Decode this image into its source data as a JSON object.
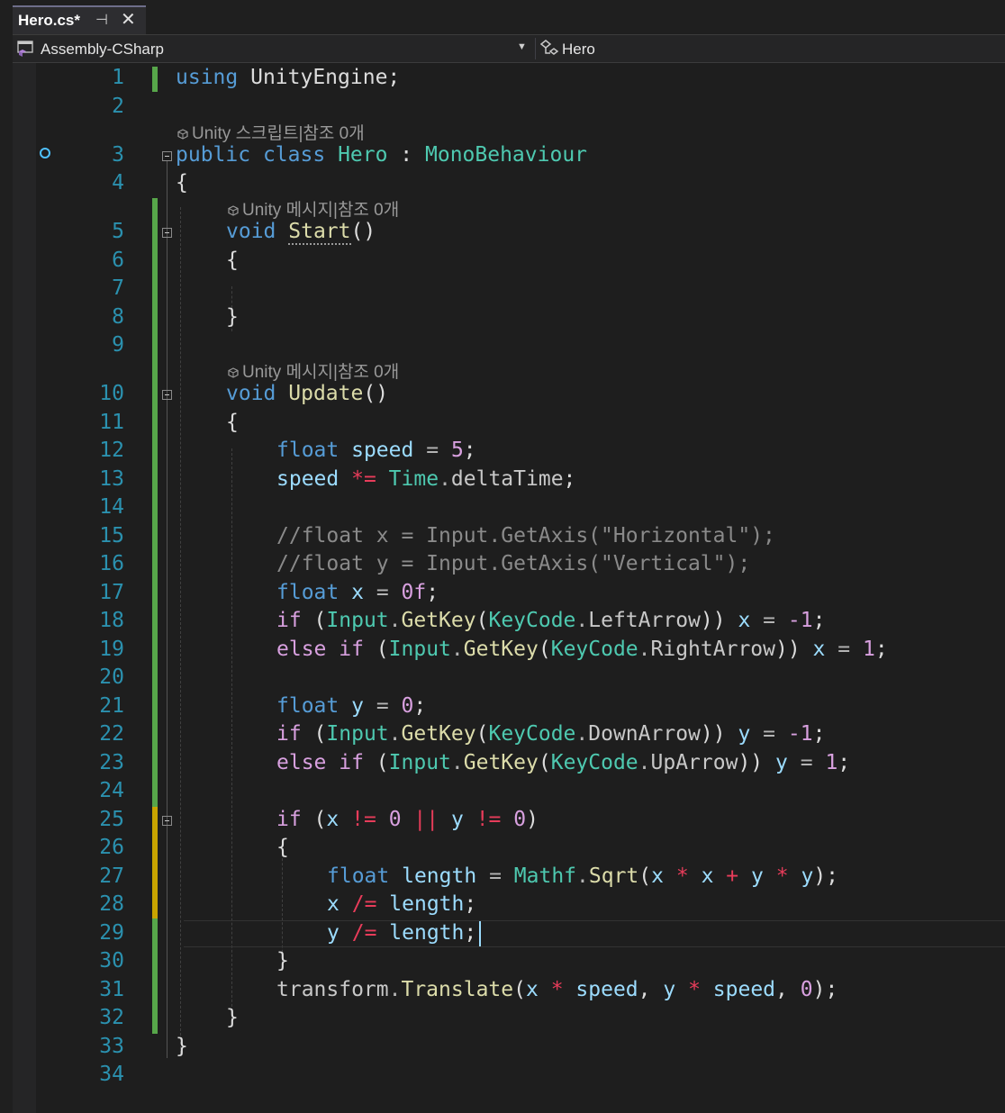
{
  "tab": {
    "title": "Hero.cs*"
  },
  "nav": {
    "project": "Assembly-CSharp",
    "class": "Hero"
  },
  "lens": {
    "class": "Unity 스크립트|참조 0개",
    "start": "Unity 메시지|참조 0개",
    "update": "Unity 메시지|참조 0개"
  },
  "line_numbers": [
    "1",
    "2",
    "3",
    "4",
    "5",
    "6",
    "7",
    "8",
    "9",
    "10",
    "11",
    "12",
    "13",
    "14",
    "15",
    "16",
    "17",
    "18",
    "19",
    "20",
    "21",
    "22",
    "23",
    "24",
    "25",
    "26",
    "27",
    "28",
    "29",
    "30",
    "31",
    "32",
    "33",
    "34"
  ],
  "code": {
    "l1": [
      "using",
      " UnityEngine;"
    ],
    "l3": [
      "public",
      " ",
      "class",
      " ",
      "Hero",
      " : ",
      "MonoBehaviour"
    ],
    "l4": "{",
    "l5": [
      "void",
      " ",
      "Start",
      "()"
    ],
    "l6": "{",
    "l8": "}",
    "l10": [
      "void",
      " ",
      "Update",
      "()"
    ],
    "l11": "{",
    "l12": [
      "float",
      " ",
      "speed",
      " ",
      "=",
      " ",
      "5",
      ";"
    ],
    "l13": [
      "speed",
      " ",
      "*=",
      " ",
      "Time",
      ".",
      "deltaTime",
      ";"
    ],
    "l15": "//float x = Input.GetAxis(\"Horizontal\");",
    "l16": "//float y = Input.GetAxis(\"Vertical\");",
    "l17": [
      "float",
      " ",
      "x",
      " ",
      "=",
      " ",
      "0f",
      ";"
    ],
    "l18": [
      "if",
      " (",
      "Input",
      ".",
      "GetKey",
      "(",
      "KeyCode",
      ".",
      "LeftArrow",
      ")) ",
      "x",
      " ",
      "=",
      " ",
      "-1",
      ";"
    ],
    "l19": [
      "else",
      " ",
      "if",
      " (",
      "Input",
      ".",
      "GetKey",
      "(",
      "KeyCode",
      ".",
      "RightArrow",
      ")) ",
      "x",
      " ",
      "=",
      " ",
      "1",
      ";"
    ],
    "l21": [
      "float",
      " ",
      "y",
      " ",
      "=",
      " ",
      "0",
      ";"
    ],
    "l22": [
      "if",
      " (",
      "Input",
      ".",
      "GetKey",
      "(",
      "KeyCode",
      ".",
      "DownArrow",
      ")) ",
      "y",
      " ",
      "=",
      " ",
      "-1",
      ";"
    ],
    "l23": [
      "else",
      " ",
      "if",
      " (",
      "Input",
      ".",
      "GetKey",
      "(",
      "KeyCode",
      ".",
      "UpArrow",
      ")) ",
      "y",
      " ",
      "=",
      " ",
      "1",
      ";"
    ],
    "l25": [
      "if",
      " (",
      "x",
      " ",
      "!=",
      " ",
      "0",
      " ",
      "||",
      " ",
      "y",
      " ",
      "!=",
      " ",
      "0",
      ")"
    ],
    "l26": "{",
    "l27": [
      "float",
      " ",
      "length",
      " ",
      "=",
      " ",
      "Mathf",
      ".",
      "Sqrt",
      "(",
      "x",
      " ",
      "*",
      " ",
      "x",
      " ",
      "+",
      " ",
      "y",
      " ",
      "*",
      " ",
      "y",
      ");"
    ],
    "l28": [
      "x",
      " ",
      "/=",
      " ",
      "length",
      ";"
    ],
    "l29": [
      "y",
      " ",
      "/=",
      " ",
      "length",
      ";"
    ],
    "l30": "}",
    "l31": [
      "transform",
      ".",
      "Translate",
      "(",
      "x",
      " ",
      "*",
      " ",
      "speed",
      ", ",
      "y",
      " ",
      "*",
      " ",
      "speed",
      ", ",
      "0",
      ");"
    ],
    "l32": "}",
    "l33": "}"
  }
}
